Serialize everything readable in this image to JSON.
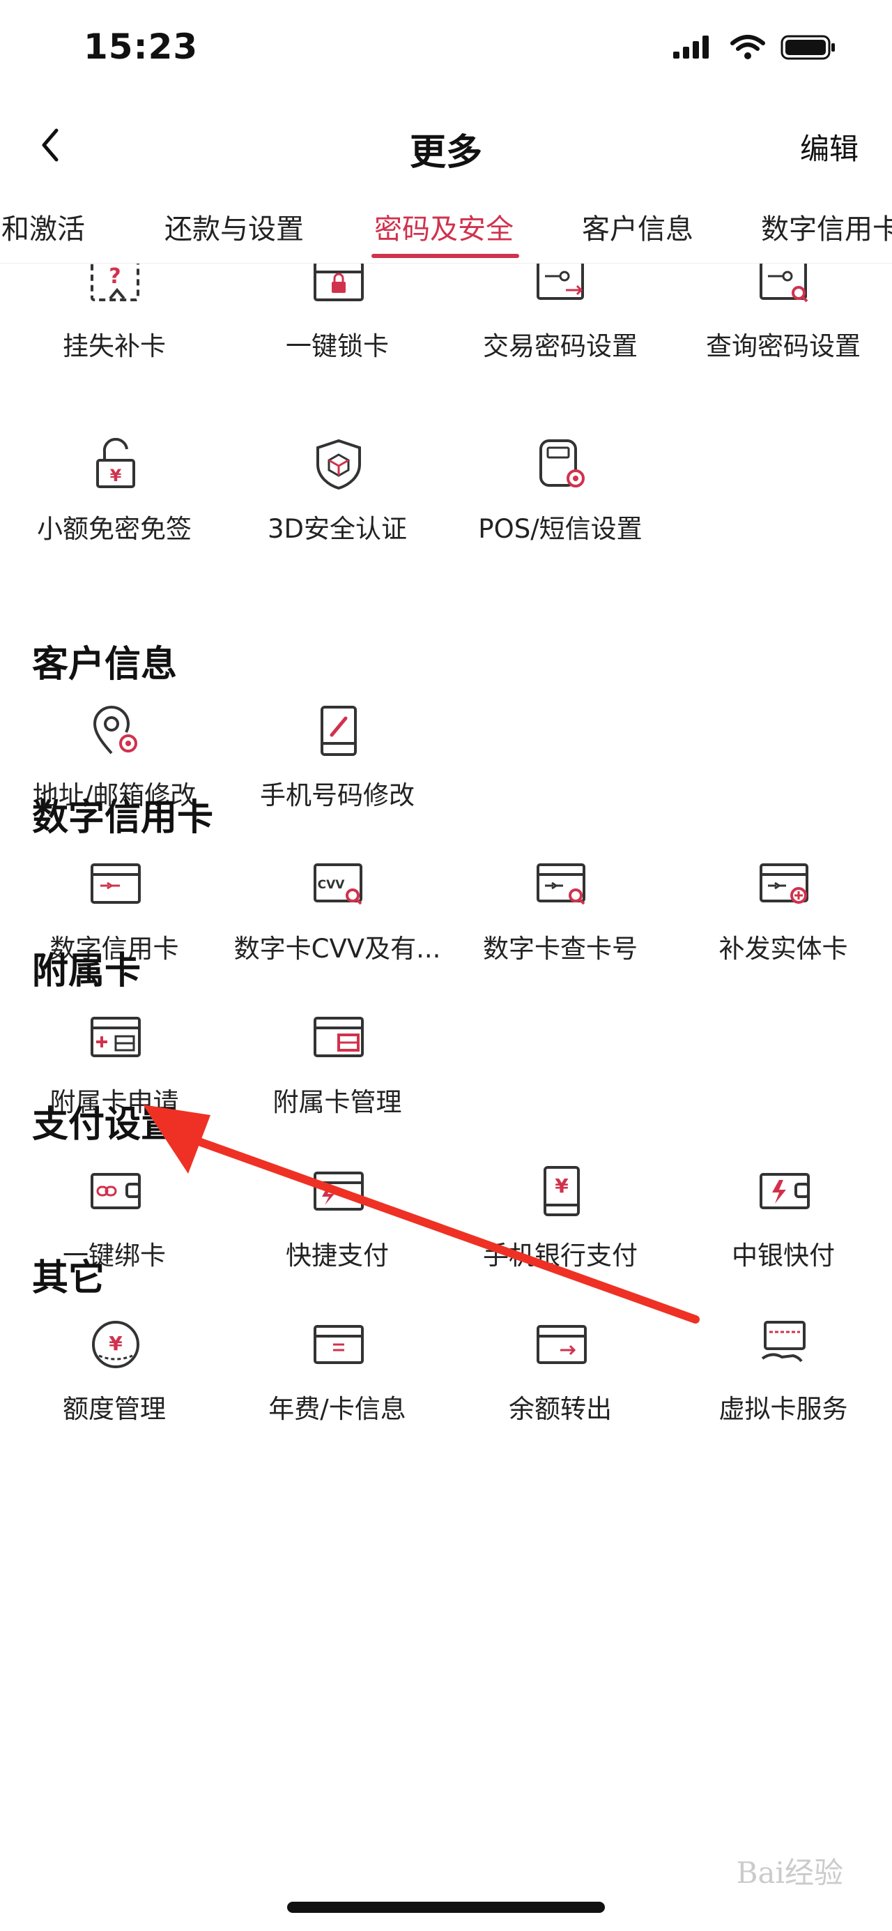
{
  "status_bar": {
    "time": "15:23"
  },
  "nav": {
    "title": "更多",
    "edit_label": "编辑"
  },
  "tabs": [
    {
      "label": "卡和激活"
    },
    {
      "label": "还款与设置"
    },
    {
      "label": "密码及安全",
      "active": true
    },
    {
      "label": "客户信息"
    },
    {
      "label": "数字信用卡"
    }
  ],
  "sections": {
    "security": {
      "items": [
        {
          "label": "挂失补卡",
          "icon": "lost-card-icon"
        },
        {
          "label": "一键锁卡",
          "icon": "lock-card-icon"
        },
        {
          "label": "交易密码设置",
          "icon": "transaction-password-icon"
        },
        {
          "label": "查询密码设置",
          "icon": "query-password-icon"
        },
        {
          "label": "小额免密免签",
          "icon": "small-payment-lock-icon"
        },
        {
          "label": "3D安全认证",
          "icon": "3d-secure-shield-icon"
        },
        {
          "label": "POS/短信设置",
          "icon": "pos-sms-settings-icon"
        }
      ]
    },
    "customer_info": {
      "title": "客户信息",
      "items": [
        {
          "label": "地址/邮箱修改",
          "icon": "address-location-icon"
        },
        {
          "label": "手机号码修改",
          "icon": "phone-edit-icon"
        }
      ]
    },
    "digital_card": {
      "title": "数字信用卡",
      "items": [
        {
          "label": "数字信用卡",
          "icon": "digital-card-icon"
        },
        {
          "label": "数字卡CVV及有...",
          "icon": "cvv-search-icon"
        },
        {
          "label": "数字卡查卡号",
          "icon": "card-number-search-icon"
        },
        {
          "label": "补发实体卡",
          "icon": "reissue-card-icon"
        }
      ]
    },
    "supplementary": {
      "title": "附属卡",
      "items": [
        {
          "label": "附属卡申请",
          "icon": "supplementary-apply-icon"
        },
        {
          "label": "附属卡管理",
          "icon": "supplementary-manage-icon"
        }
      ]
    },
    "payment": {
      "title": "支付设置",
      "items": [
        {
          "label": "一键绑卡",
          "icon": "bind-card-icon"
        },
        {
          "label": "快捷支付",
          "icon": "quick-pay-icon"
        },
        {
          "label": "手机银行支付",
          "icon": "mobile-bank-pay-icon"
        },
        {
          "label": "中银快付",
          "icon": "boc-quick-pay-icon"
        }
      ]
    },
    "other": {
      "title": "其它",
      "items": [
        {
          "label": "额度管理",
          "icon": "credit-limit-icon"
        },
        {
          "label": "年费/卡信息",
          "icon": "annual-fee-icon"
        },
        {
          "label": "余额转出",
          "icon": "balance-transfer-icon"
        },
        {
          "label": "虚拟卡服务",
          "icon": "virtual-card-icon"
        }
      ]
    }
  },
  "watermark": "Bai经验",
  "colors": {
    "accent": "#d0324d",
    "arrow": "#ee3124",
    "text": "#222222"
  }
}
